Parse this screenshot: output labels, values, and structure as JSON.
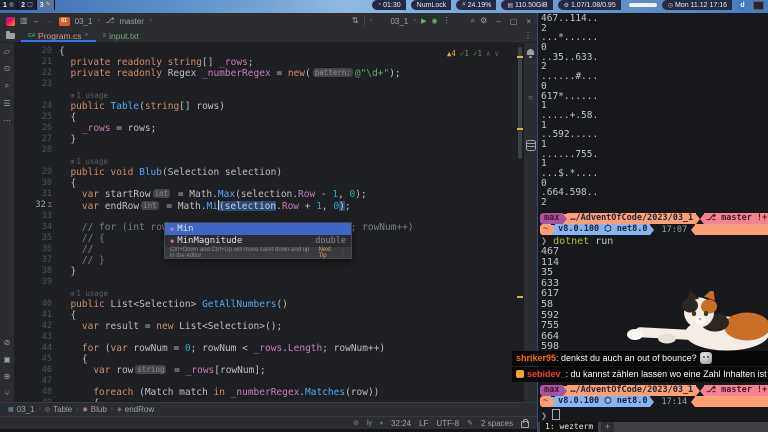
{
  "topbar": {
    "workspaces": [
      {
        "num": "1",
        "icon": "globe"
      },
      {
        "num": "2",
        "icon": "monitor"
      },
      {
        "num": "3",
        "icon": "pencil",
        "active": true
      }
    ],
    "icon_glyphs": {
      "globe": "◍",
      "monitor": "▢",
      "pencil": "✎"
    },
    "segments": [
      {
        "name": "uptime",
        "glyph": "◔",
        "text": "01:30"
      },
      {
        "name": "numlock",
        "glyph": "",
        "text": "NumLock"
      },
      {
        "name": "cpu",
        "glyph": "#",
        "text": "24.19%"
      },
      {
        "name": "disk",
        "glyph": "▤",
        "text": "110.50GiB"
      },
      {
        "name": "load",
        "glyph": "⚙",
        "text": "1.07/1.08/0.95"
      },
      {
        "name": "volume-bar",
        "type": "bar"
      },
      {
        "name": "clock",
        "glyph": "◷",
        "text": "Mon 11.12 17:16"
      }
    ],
    "tray_d_label": "d"
  },
  "ide": {
    "titlebar": {
      "back": "←",
      "forward": "→",
      "solution_badge": "01",
      "solution": "03_1",
      "chevron": "˅",
      "vcs_icon": "⇅",
      "branch_icon": "⎇",
      "branch": "master",
      "run_config": "03_1",
      "play": "▶",
      "bug": "◉",
      "kebab": "⋮",
      "search": "⌕",
      "gear": "⚙",
      "minimize": "–",
      "maximize": "▢",
      "close": "×"
    },
    "tabs": [
      {
        "label": "Program.cs",
        "icon_label": "C#",
        "close": "×",
        "active": true
      },
      {
        "label": "input.txt",
        "icon_label": "≡",
        "active": false
      }
    ],
    "tabs_kebab": "⋮",
    "inspections": {
      "warn_glyph": "▲",
      "warnings": "4",
      "ok_glyph": "✓",
      "ok1": "1",
      "ok2": "1",
      "up": "∧",
      "down": "∨"
    },
    "left_stripe": [
      {
        "name": "project-folder",
        "glyph": "▱"
      },
      {
        "name": "commit",
        "glyph": "⊙"
      },
      {
        "name": "search-everywhere",
        "glyph": "⌕"
      },
      {
        "name": "structure",
        "glyph": "☰"
      },
      {
        "name": "more-tools",
        "glyph": "⋯"
      }
    ],
    "left_stripe_bottom": [
      {
        "name": "run-tool",
        "glyph": "⊘"
      },
      {
        "name": "terminal-tool",
        "glyph": "▣"
      },
      {
        "name": "problems-tool",
        "glyph": "⊕"
      },
      {
        "name": "services-tool",
        "glyph": "⑂"
      }
    ],
    "editor": {
      "usage_icon": "⊞",
      "gutter_icon": "⌶",
      "lines": [
        {
          "n": "20",
          "t": [
            [
              "{",
              "p"
            ]
          ]
        },
        {
          "n": "21",
          "t": [
            [
              "  ",
              "p"
            ],
            [
              "private readonly string",
              "k"
            ],
            [
              "[] ",
              "p"
            ],
            [
              "_rows",
              "f"
            ],
            [
              ";",
              "p"
            ]
          ]
        },
        {
          "n": "22",
          "t": [
            [
              "  ",
              "p"
            ],
            [
              "private readonly ",
              "k"
            ],
            [
              "Regex ",
              "p"
            ],
            [
              "_numberRegex",
              "f"
            ],
            [
              " = ",
              "p"
            ],
            [
              "new",
              "k"
            ],
            [
              "(",
              "p"
            ],
            [
              "pattern:",
              "i"
            ],
            [
              "@\"\\d+\"",
              "s"
            ],
            [
              ");",
              "p"
            ]
          ]
        },
        {
          "n": "23",
          "t": []
        },
        {
          "usage": "1 usage"
        },
        {
          "n": "24",
          "t": [
            [
              "  ",
              "p"
            ],
            [
              "public ",
              "k"
            ],
            [
              "Table",
              "d"
            ],
            [
              "(",
              "p"
            ],
            [
              "string",
              "k"
            ],
            [
              "[] ",
              "p"
            ],
            [
              "rows)",
              "p"
            ]
          ]
        },
        {
          "n": "25",
          "t": [
            [
              "  {",
              "p"
            ]
          ]
        },
        {
          "n": "26",
          "t": [
            [
              "    ",
              "p"
            ],
            [
              "_rows",
              "f"
            ],
            [
              " = ",
              "p"
            ],
            [
              "rows",
              "p"
            ],
            [
              ";",
              "p"
            ]
          ]
        },
        {
          "n": "27",
          "t": [
            [
              "  }",
              "p"
            ]
          ]
        },
        {
          "n": "28",
          "t": []
        },
        {
          "usage": "1 usage"
        },
        {
          "n": "29",
          "t": [
            [
              "  ",
              "p"
            ],
            [
              "public void ",
              "k"
            ],
            [
              "Blub",
              "d"
            ],
            [
              "(",
              "p"
            ],
            [
              "Selection selection)",
              "p"
            ]
          ]
        },
        {
          "n": "30",
          "t": [
            [
              "  {",
              "p"
            ]
          ]
        },
        {
          "n": "31",
          "t": [
            [
              "    ",
              "p"
            ],
            [
              "var ",
              "k"
            ],
            [
              "startRow",
              "p"
            ],
            [
              "int",
              "i"
            ],
            [
              " = ",
              "p"
            ],
            [
              "Math",
              "p"
            ],
            [
              ".",
              "p"
            ],
            [
              "Max",
              "m"
            ],
            [
              "(selection",
              "p"
            ],
            [
              ".",
              "p"
            ],
            [
              "Row",
              "f"
            ],
            [
              " - ",
              "p"
            ],
            [
              "1",
              "n"
            ],
            [
              ", ",
              "p"
            ],
            [
              "0",
              "n"
            ],
            [
              ");",
              "p"
            ]
          ]
        },
        {
          "n": "32",
          "cur": true,
          "t": [
            [
              "    ",
              "p"
            ],
            [
              "var ",
              "k"
            ],
            [
              "endRow",
              "p"
            ],
            [
              "int",
              "i"
            ],
            [
              " = ",
              "p"
            ],
            [
              "Math",
              "p"
            ],
            [
              ".",
              "p"
            ],
            [
              "Mi",
              "m"
            ],
            [
              "",
              "caret"
            ],
            [
              "(selection",
              "hl"
            ],
            [
              ".",
              "p"
            ],
            [
              "Row",
              "f"
            ],
            [
              " + ",
              "p"
            ],
            [
              "1",
              "n"
            ],
            [
              ", ",
              "p"
            ],
            [
              "0",
              "n"
            ],
            [
              ")",
              "hl"
            ],
            [
              ";",
              "p"
            ]
          ]
        },
        {
          "n": "33",
          "t": []
        },
        {
          "n": "34",
          "t": [
            [
              "    ",
              "p"
            ],
            [
              "// for (int rowNum = startRow; rowNum <= endRow; rowNum++)",
              "c"
            ]
          ]
        },
        {
          "n": "35",
          "t": [
            [
              "    ",
              "p"
            ],
            [
              "// {",
              "c"
            ]
          ]
        },
        {
          "n": "36",
          "t": [
            [
              "    ",
              "p"
            ],
            [
              "//",
              "c"
            ]
          ]
        },
        {
          "n": "37",
          "t": [
            [
              "    ",
              "p"
            ],
            [
              "// }",
              "c"
            ]
          ]
        },
        {
          "n": "38",
          "t": [
            [
              "  }",
              "p"
            ]
          ]
        },
        {
          "n": "39",
          "t": []
        },
        {
          "usage": "1 usage"
        },
        {
          "n": "40",
          "t": [
            [
              "  ",
              "p"
            ],
            [
              "public ",
              "k"
            ],
            [
              "List",
              "p"
            ],
            [
              "<",
              "p"
            ],
            [
              "Selection",
              "p"
            ],
            [
              "> ",
              "p"
            ],
            [
              "GetAllNumbers",
              "g"
            ],
            [
              "()",
              "p"
            ]
          ]
        },
        {
          "n": "41",
          "t": [
            [
              "  {",
              "p"
            ]
          ]
        },
        {
          "n": "42",
          "t": [
            [
              "    ",
              "p"
            ],
            [
              "var ",
              "k"
            ],
            [
              "result",
              "p"
            ],
            [
              " = ",
              "p"
            ],
            [
              "new ",
              "k"
            ],
            [
              "List",
              "p"
            ],
            [
              "<",
              "p"
            ],
            [
              "Selection",
              "p"
            ],
            [
              ">();",
              "p"
            ]
          ]
        },
        {
          "n": "43",
          "t": []
        },
        {
          "n": "44",
          "t": [
            [
              "    ",
              "p"
            ],
            [
              "for",
              "k"
            ],
            [
              " (",
              "p"
            ],
            [
              "var ",
              "k"
            ],
            [
              "rowNum",
              "p"
            ],
            [
              " = ",
              "p"
            ],
            [
              "0",
              "n"
            ],
            [
              "; rowNum < ",
              "p"
            ],
            [
              "_rows",
              "f"
            ],
            [
              ".",
              "p"
            ],
            [
              "Length",
              "f"
            ],
            [
              "; rowNum++)",
              "p"
            ]
          ]
        },
        {
          "n": "45",
          "t": [
            [
              "    {",
              "p"
            ]
          ]
        },
        {
          "n": "46",
          "t": [
            [
              "      ",
              "p"
            ],
            [
              "var ",
              "k"
            ],
            [
              "row",
              "p"
            ],
            [
              "string",
              "i"
            ],
            [
              " = ",
              "p"
            ],
            [
              "_rows",
              "f"
            ],
            [
              "[rowNum];",
              "p"
            ]
          ]
        },
        {
          "n": "47",
          "t": []
        },
        {
          "n": "48",
          "t": [
            [
              "      ",
              "p"
            ],
            [
              "foreach",
              "k"
            ],
            [
              " (",
              "p"
            ],
            [
              "Match match ",
              "p"
            ],
            [
              "in",
              "k"
            ],
            [
              " ",
              "p"
            ],
            [
              "_numberRegex",
              "f"
            ],
            [
              ".",
              "p"
            ],
            [
              "Matches",
              "m"
            ],
            [
              "(row))",
              "p"
            ]
          ]
        },
        {
          "n": "49",
          "t": [
            [
              "      {",
              "p"
            ]
          ]
        }
      ]
    },
    "popup": {
      "items": [
        {
          "label": "Min",
          "selected": true,
          "type": ""
        },
        {
          "label": "MinMagnitude",
          "selected": false,
          "type": "double"
        }
      ],
      "icon_glyph": "◆",
      "hint": "Ctrl+Down and Ctrl+Up will move caret down and up in the editor",
      "hint_link": "Next Tip",
      "hint_kebab": "⋮"
    },
    "breadcrumbs": [
      {
        "label": "03_1",
        "glyph": "▦",
        "color": "#6897bb"
      },
      {
        "label": "Table",
        "glyph": "◎",
        "color": "#b09a53"
      },
      {
        "label": "Blub",
        "glyph": "◉",
        "color": "#c77dbb"
      },
      {
        "label": "endRow",
        "glyph": "◈",
        "color": "#9876aa"
      }
    ],
    "breadcrumb_sep": "›",
    "statusbar": {
      "icon1": "⊘",
      "icon2": "ly",
      "green_glyph": "▾",
      "position": "32:24",
      "line_sep": "LF",
      "encoding": "UTF-8",
      "pencil": "✎",
      "indent": "2 spaces"
    }
  },
  "terminal": {
    "grid": [
      "467..114..",
      "2",
      "...*......",
      "0",
      "..35..633.",
      "2",
      "......#...",
      "0",
      "617*......",
      "1",
      ".....+.58.",
      "1",
      "..592.....",
      "1",
      "......755.",
      "1",
      "...$.*....",
      "0",
      ".664.598..",
      "2"
    ],
    "prompt1": {
      "user": "max",
      "path": "…/AdventOfCode/2023/03_1",
      "branch_glyph": "⎇",
      "git": "master !+?",
      "tilde": "~",
      "sdk": "v8.0.100",
      "dotnet_glyph": "⬡",
      "framework": "net8.0",
      "time": "17:07"
    },
    "command": {
      "prompt_glyph": "❯",
      "cmd": "dotnet",
      "arg": "run"
    },
    "outputs": [
      "467",
      "114",
      "35",
      "633",
      "617",
      "58",
      "592",
      "755",
      "664",
      "598"
    ],
    "prompt2": {
      "user": "max",
      "path": "…/AdventOfCode/2023/03_1",
      "branch_glyph": "⎇",
      "git": "master !+?",
      "tilde": "~",
      "sdk": "v8.0.100",
      "dotnet_glyph": "⬡",
      "framework": "net8.0",
      "time": "17:14"
    },
    "cursor_prompt_glyph": "❯",
    "tmux": {
      "tab": "1: wezterm",
      "plus": "+"
    }
  },
  "chat": {
    "messages": [
      {
        "user": "shriker95",
        "color": "#ff6a00",
        "badge": false,
        "text": "denkst du auch an out of bounce?",
        "emote": true
      },
      {
        "user": "sebidev_",
        "color": "#e8452c",
        "badge": true,
        "text": "du kannst zählen lassen wo eine Zahl Inhalten ist",
        "emote": false
      }
    ]
  }
}
